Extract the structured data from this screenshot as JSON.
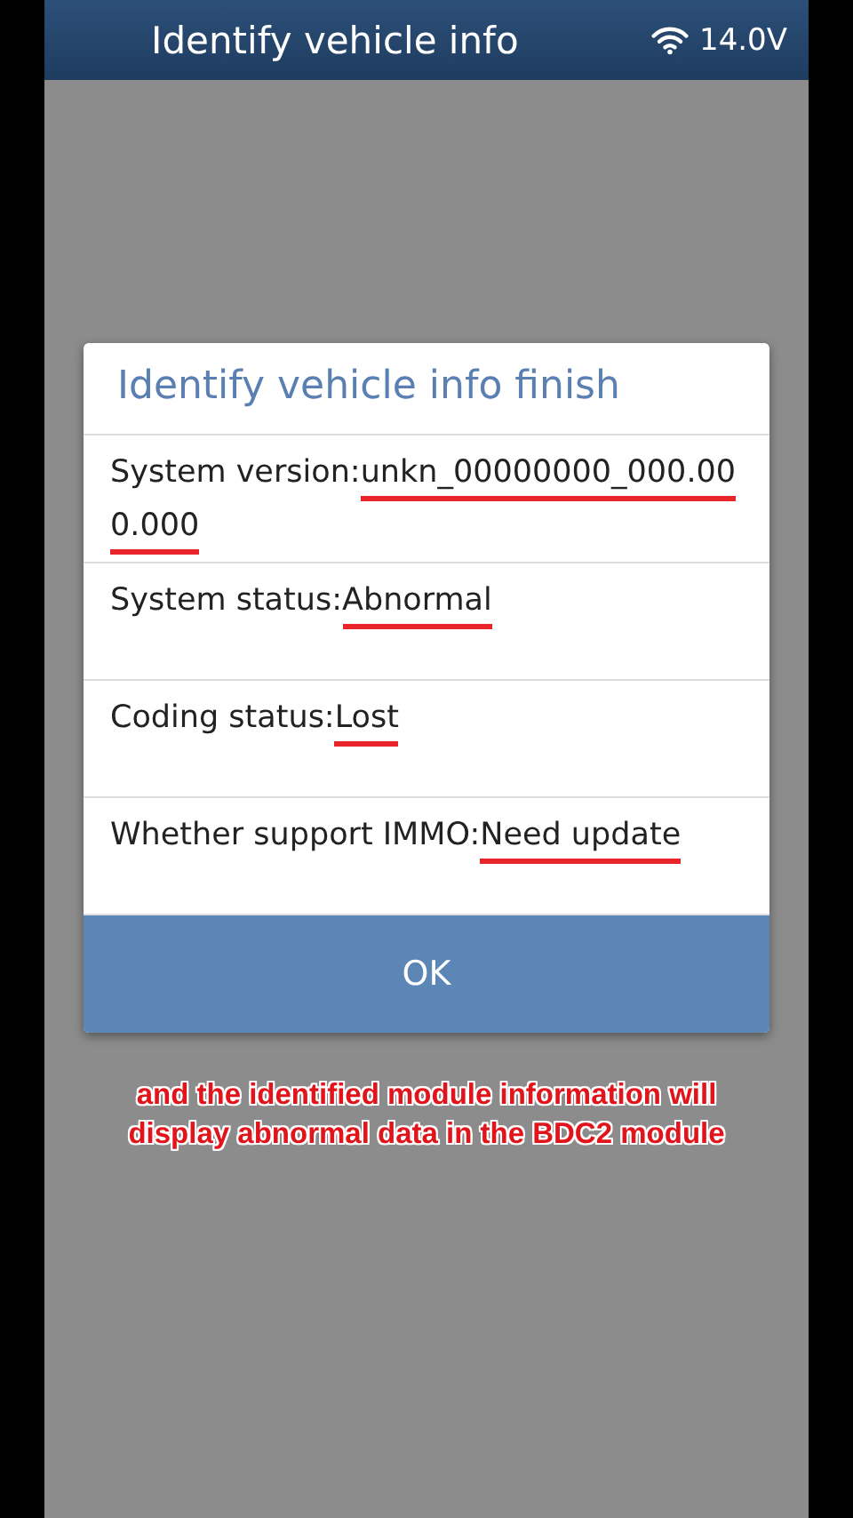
{
  "header": {
    "title": "Identify vehicle info",
    "voltage": "14.0V"
  },
  "dialog": {
    "title": "Identify vehicle info finish",
    "rows": [
      {
        "label": "System version:",
        "value": "unkn_00000000_000.000.000",
        "highlighted": true
      },
      {
        "label": "System status:",
        "value": "Abnormal",
        "highlighted": true
      },
      {
        "label": "Coding status:",
        "value": "Lost",
        "highlighted": true
      },
      {
        "label": "Whether support IMMO:",
        "value": "Need update",
        "highlighted": true
      }
    ],
    "button": "OK"
  },
  "caption": "and the identified module information will display abnormal data in the BDC2 module"
}
